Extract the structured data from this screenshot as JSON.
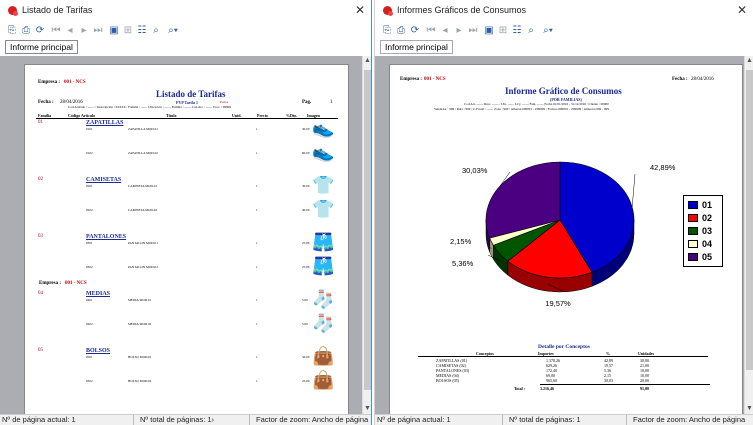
{
  "left_window": {
    "title": "Listado de Tarifas",
    "tab": "Informe principal",
    "report": {
      "empresa_label": "Empresa :",
      "empresa_value": "001 - NCS",
      "title": "Listado de Tarifas",
      "fecha_label": "Fecha :",
      "fecha_value": "28/04/2016",
      "pag_label": "Pag.",
      "pag_value": "1",
      "subtitle": "PVP Tarifa 1",
      "subtitle_extra": "Euros",
      "filters": "Cod.Artículo : ------ / Descripción : ZZZZZ / Familia : ------ Ubicación : ------ Familia : ------ Cod.Art. : ------ Prov. : 99999",
      "columns": {
        "familia": "Familia",
        "codigo": "Código Artículo",
        "titulo": "Título",
        "unid": "Unid.",
        "precio": "Precio",
        "dto": "%Dto.",
        "imagen": "Imagen"
      },
      "groups": [
        {
          "code": "01",
          "name": "ZAPATILLAS",
          "items": [
            {
              "code": "0101",
              "title": "ZAPATILLA MOD.01",
              "unid": "1",
              "price": "30,00",
              "img": "sneaker"
            },
            {
              "code": "0102",
              "title": "ZAPATILLA MOD.02",
              "unid": "1",
              "price": "60,00",
              "img": "sneaker2"
            }
          ]
        },
        {
          "code": "02",
          "name": "CAMISETAS",
          "items": [
            {
              "code": "0201",
              "title": "CAMISETA MOD.01",
              "unid": "1",
              "price": "30,00",
              "img": "tshirt-dark"
            },
            {
              "code": "0202",
              "title": "CAMISETA MOD.02",
              "unid": "1",
              "price": "40,00",
              "img": "tshirt-white"
            }
          ]
        },
        {
          "code": "03",
          "name": "PANTALONES",
          "items": [
            {
              "code": "0301",
              "title": "PANTALON MOD.01",
              "unid": "1",
              "price": "25,00",
              "img": "shorts-dark"
            },
            {
              "code": "0302",
              "title": "PANTALON MOD.02",
              "unid": "1",
              "price": "25,00",
              "img": "shorts-blue"
            }
          ]
        },
        {
          "code": "04",
          "name": "MEDIAS",
          "items": [
            {
              "code": "0401",
              "title": "MEDIA MOD.01",
              "unid": "1",
              "price": "5,00",
              "img": "socks"
            },
            {
              "code": "0402",
              "title": "MEDIA MOD.02",
              "unid": "1",
              "price": "5,00",
              "img": "sock-blue"
            }
          ]
        },
        {
          "code": "05",
          "name": "BOLSOS",
          "items": [
            {
              "code": "0501",
              "title": "BOLSO MOD.01",
              "unid": "1",
              "price": "50,00",
              "img": "bag"
            },
            {
              "code": "0502",
              "title": "BOLSO MOD.02",
              "unid": "1",
              "price": "25,00",
              "img": "bag2"
            }
          ]
        }
      ]
    },
    "status": {
      "current_page": "Nº de página actual: 1",
      "total_pages": "Nº total de páginas: 1›",
      "zoom": "Factor de zoom: Ancho de página"
    }
  },
  "right_window": {
    "title": "Informes Gráficos de Consumos",
    "tab": "Informe principal",
    "report": {
      "empresa_label": "Empresa :",
      "empresa_value": "001 - NCS",
      "fecha_label": "Fecha :",
      "fecha_value": "28/04/2016",
      "title": "Informe Gráfico de Consumos",
      "subtitle": "(POR FAMILIAS)",
      "filters1": "Cod.Art. ------ Desc. ------ / Ubi. ------ Ucy. ------ Fam. ------ Fecha 01/01/2016 - 31/12/2016 / Cliente : 00000",
      "filters2": "Vendedor : 999 / Ruta : 999 / C.Postal : ------ Zona : 999 / Albaran 000001 - Z99999 / Factura 000001 - Z99999 / Almacen 000 - 999",
      "detail_title": "Detalle por Conceptos",
      "detail_headers": {
        "conceptos": "Conceptos",
        "importes": "Importes",
        "pct": "%",
        "unidades": "Unidades"
      },
      "detail_rows": [
        {
          "name": "ZAPATILLAS (01)",
          "importe": "1.378,26",
          "pct": "42,89",
          "unid": "30,00"
        },
        {
          "name": "CAMISETAS (02)",
          "importe": "629,26",
          "pct": "19,57",
          "unid": "21,00"
        },
        {
          "name": "PANTALONES (03)",
          "importe": "172,40",
          "pct": "5,36",
          "unid": "10,00"
        },
        {
          "name": "MEDIAS (04)",
          "importe": "69,00",
          "pct": "2,15",
          "unid": "10,00"
        },
        {
          "name": "BOLSOS (05)",
          "importe": "965,60",
          "pct": "30,03",
          "unid": "20,00"
        }
      ],
      "total_label": "Total :",
      "total_importe": "3.216,46",
      "total_unid": "91,00"
    },
    "status": {
      "current_page": "Nº de página actual: 1",
      "total_pages": "Nº total de páginas: 1",
      "zoom": "Factor de zoom: Ancho de página"
    }
  },
  "chart_data": {
    "type": "pie",
    "categories": [
      "01",
      "02",
      "03",
      "04",
      "05"
    ],
    "values": [
      42.89,
      19.57,
      5.36,
      2.15,
      30.03
    ],
    "value_labels": [
      "42,89%",
      "19,57%",
      "5,36%",
      "2,15%",
      "30,03%"
    ],
    "colors": [
      "#0000cc",
      "#ff0000",
      "#005500",
      "#ffffcc",
      "#4b0082"
    ],
    "legend_position": "right",
    "style": "3d"
  },
  "toolbar_icons": [
    "export-icon",
    "print-icon",
    "refresh-icon",
    "first-page-icon",
    "prev-page-icon",
    "next-page-icon",
    "last-page-icon",
    "zoom-icon",
    "page-setup-icon",
    "tree-icon",
    "search-icon",
    "find-options-icon"
  ]
}
